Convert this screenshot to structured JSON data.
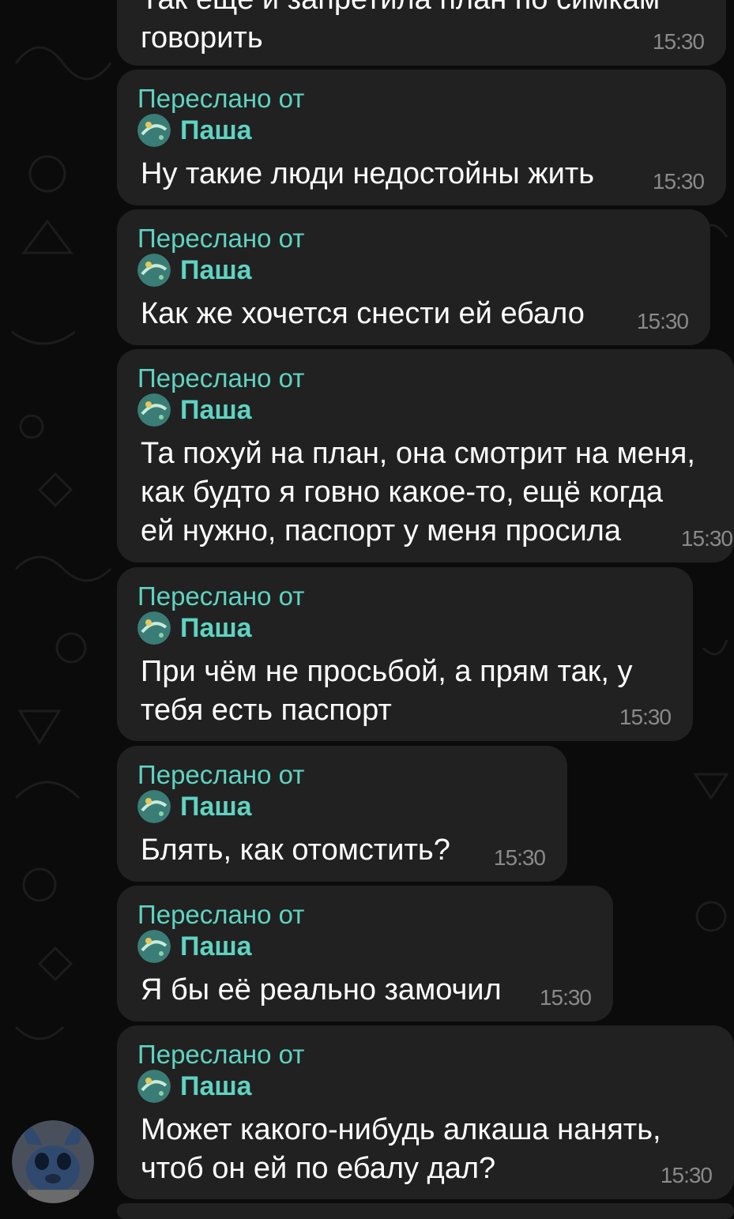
{
  "colors": {
    "background": "#0b0b0b",
    "bubble": "#212121",
    "accent": "#5fd3c2",
    "text": "#ffffff",
    "time": "#8a8a8a"
  },
  "top_partial_message": {
    "lines": [
      "Так ещё и запретила план по симкам",
      "говорить"
    ],
    "time": "15:30"
  },
  "messages": [
    {
      "forwarded_label": "Переслано от",
      "sender": "Паша",
      "text": "Ну такие люди недостойны жить",
      "time": "15:30"
    },
    {
      "forwarded_label": "Переслано от",
      "sender": "Паша",
      "text": "Как же хочется снести ей ебало",
      "time": "15:30"
    },
    {
      "forwarded_label": "Переслано от",
      "sender": "Паша",
      "text": "Та похуй на план, она смотрит на меня,\nкак будто я говно какое-то, ещё когда\nей нужно, паспорт у меня просила",
      "time": "15:30"
    },
    {
      "forwarded_label": "Переслано от",
      "sender": "Паша",
      "text": "При чём не просьбой, а прям так, у\nтебя есть паспорт",
      "time": "15:30"
    },
    {
      "forwarded_label": "Переслано от",
      "sender": "Паша",
      "text": "Блять, как отомстить?",
      "time": "15:30"
    },
    {
      "forwarded_label": "Переслано от",
      "sender": "Паша",
      "text": "Я бы её реально замочил",
      "time": "15:30"
    },
    {
      "forwarded_label": "Переслано от",
      "sender": "Паша",
      "text": "Может какого-нибудь алкаша нанять,\nчтоб он ей по ебалу дал?",
      "time": "15:30"
    }
  ]
}
